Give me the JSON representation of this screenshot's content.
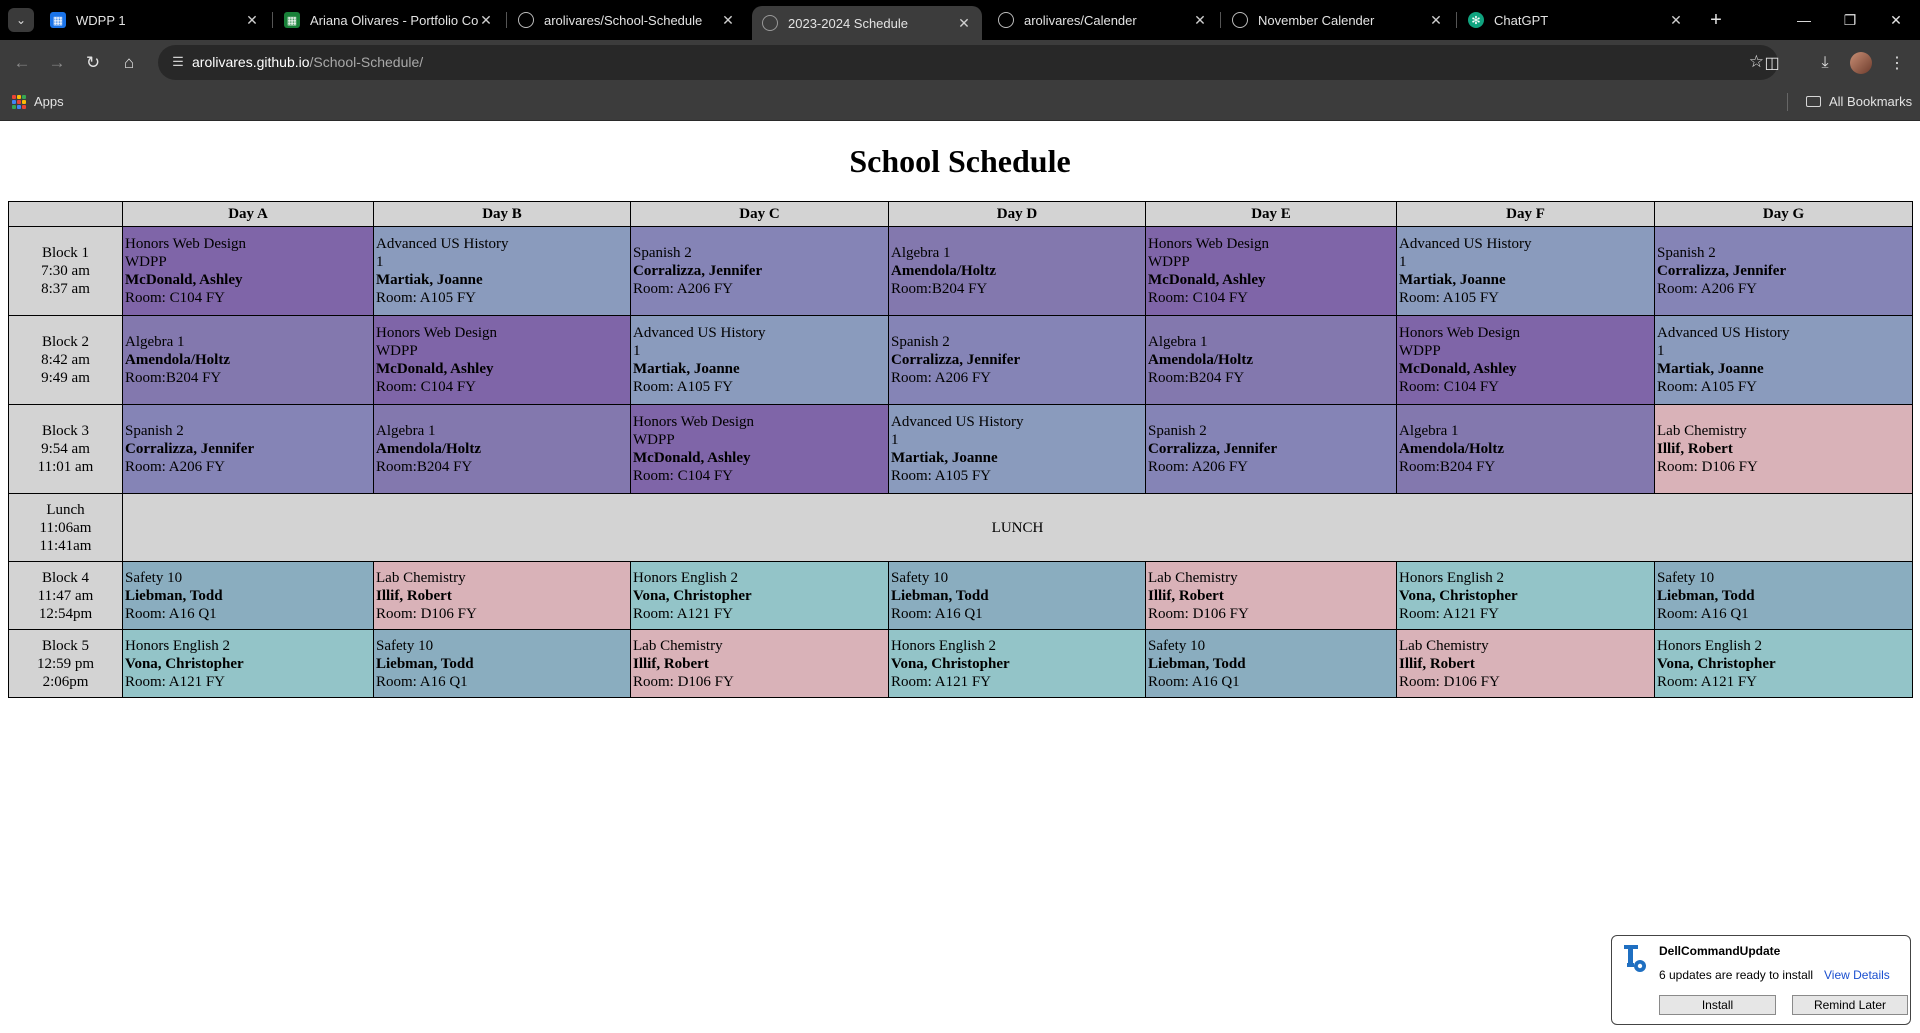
{
  "browser": {
    "tabs": [
      {
        "label": "WDPP 1",
        "icon": "site-icon"
      },
      {
        "label": "Ariana Olivares - Portfolio Cont",
        "icon": "sheets-icon"
      },
      {
        "label": "arolivares/School-Schedule",
        "icon": "github-icon"
      },
      {
        "label": "2023-2024 Schedule",
        "icon": "globe-icon"
      },
      {
        "label": "arolivares/Calender",
        "icon": "github-icon"
      },
      {
        "label": "November Calender",
        "icon": "globe-icon"
      },
      {
        "label": "ChatGPT",
        "icon": "chatgpt-icon"
      }
    ],
    "active_tab": "2023-2024 Schedule",
    "url_host": "arolivares.github.io",
    "url_path": "/School-Schedule/",
    "bookmarks": {
      "apps_label": "Apps",
      "all_label": "All Bookmarks"
    }
  },
  "page": {
    "title": "School Schedule",
    "days": [
      "Day A",
      "Day B",
      "Day C",
      "Day D",
      "Day E",
      "Day F",
      "Day G"
    ],
    "rows": [
      {
        "block": [
          "Block 1",
          "7:30 am",
          "8:37 am"
        ],
        "cells": [
          {
            "type": "webdesign",
            "lines": [
              "Honors Web Design",
              "WDPP"
            ],
            "teacher": "McDonald, Ashley",
            "room": "Room: C104 FY"
          },
          {
            "type": "history",
            "lines": [
              "Advanced US History",
              "1"
            ],
            "teacher": "Martiak, Joanne",
            "room": "Room: A105 FY"
          },
          {
            "type": "spanish",
            "lines": [
              "Spanish 2"
            ],
            "teacher": "Corralizza, Jennifer",
            "room": "Room: A206 FY"
          },
          {
            "type": "algebra",
            "lines": [
              "Algebra 1"
            ],
            "teacher": "Amendola/Holtz",
            "room": "Room:B204 FY"
          },
          {
            "type": "webdesign",
            "lines": [
              "Honors Web Design",
              "WDPP"
            ],
            "teacher": "McDonald, Ashley",
            "room": "Room: C104 FY"
          },
          {
            "type": "history",
            "lines": [
              "Advanced US History",
              "1"
            ],
            "teacher": "Martiak, Joanne",
            "room": "Room: A105 FY"
          },
          {
            "type": "spanish",
            "lines": [
              "Spanish 2"
            ],
            "teacher": "Corralizza, Jennifer",
            "room": "Room: A206 FY"
          }
        ]
      },
      {
        "block": [
          "Block 2",
          "8:42 am",
          "9:49 am"
        ],
        "cells": [
          {
            "type": "algebra",
            "lines": [
              "Algebra 1"
            ],
            "teacher": "Amendola/Holtz",
            "room": "Room:B204 FY"
          },
          {
            "type": "webdesign",
            "lines": [
              "Honors Web Design",
              "WDPP"
            ],
            "teacher": "McDonald, Ashley",
            "room": "Room: C104 FY"
          },
          {
            "type": "history",
            "lines": [
              "Advanced US History",
              "1"
            ],
            "teacher": "Martiak, Joanne",
            "room": "Room: A105 FY"
          },
          {
            "type": "spanish",
            "lines": [
              "Spanish 2"
            ],
            "teacher": "Corralizza, Jennifer",
            "room": "Room: A206 FY"
          },
          {
            "type": "algebra",
            "lines": [
              "Algebra 1"
            ],
            "teacher": "Amendola/Holtz",
            "room": "Room:B204 FY"
          },
          {
            "type": "webdesign",
            "lines": [
              "Honors Web Design",
              "WDPP"
            ],
            "teacher": "McDonald, Ashley",
            "room": "Room: C104 FY"
          },
          {
            "type": "history",
            "lines": [
              "Advanced US History",
              "1"
            ],
            "teacher": "Martiak, Joanne",
            "room": "Room: A105 FY"
          }
        ]
      },
      {
        "block": [
          "Block 3",
          "9:54 am",
          "11:01 am"
        ],
        "cells": [
          {
            "type": "spanish",
            "lines": [
              "Spanish 2"
            ],
            "teacher": "Corralizza, Jennifer",
            "room": "Room: A206 FY"
          },
          {
            "type": "algebra",
            "lines": [
              "Algebra 1"
            ],
            "teacher": "Amendola/Holtz",
            "room": "Room:B204 FY"
          },
          {
            "type": "webdesign",
            "lines": [
              "Honors Web Design",
              "WDPP"
            ],
            "teacher": "McDonald, Ashley",
            "room": "Room: C104 FY"
          },
          {
            "type": "history",
            "lines": [
              "Advanced US History",
              "1"
            ],
            "teacher": "Martiak, Joanne",
            "room": "Room: A105 FY"
          },
          {
            "type": "spanish",
            "lines": [
              "Spanish 2"
            ],
            "teacher": "Corralizza, Jennifer",
            "room": "Room: A206 FY"
          },
          {
            "type": "algebra",
            "lines": [
              "Algebra 1"
            ],
            "teacher": "Amendola/Holtz",
            "room": "Room:B204 FY"
          },
          {
            "type": "chem",
            "lines": [
              "Lab Chemistry"
            ],
            "teacher": "Illif, Robert",
            "room": "Room: D106 FY"
          }
        ]
      },
      {
        "block": [
          "Lunch",
          "11:06am",
          "11:41am"
        ],
        "lunch": "LUNCH"
      },
      {
        "block": [
          "Block 4",
          "11:47 am",
          "12:54pm"
        ],
        "cells": [
          {
            "type": "safety",
            "lines": [
              "Safety 10"
            ],
            "teacher": "Liebman, Todd",
            "room": "Room: A16 Q1"
          },
          {
            "type": "chem",
            "lines": [
              "Lab Chemistry"
            ],
            "teacher": "Illif, Robert",
            "room": "Room: D106 FY"
          },
          {
            "type": "english",
            "lines": [
              "Honors English 2"
            ],
            "teacher": "Vona, Christopher",
            "room": "Room: A121 FY"
          },
          {
            "type": "safety",
            "lines": [
              "Safety 10"
            ],
            "teacher": "Liebman, Todd",
            "room": "Room: A16 Q1"
          },
          {
            "type": "chem",
            "lines": [
              "Lab Chemistry"
            ],
            "teacher": "Illif, Robert",
            "room": "Room: D106 FY"
          },
          {
            "type": "english",
            "lines": [
              "Honors English 2"
            ],
            "teacher": "Vona, Christopher",
            "room": "Room: A121 FY"
          },
          {
            "type": "safety",
            "lines": [
              "Safety 10"
            ],
            "teacher": "Liebman, Todd",
            "room": "Room: A16 Q1"
          }
        ]
      },
      {
        "block": [
          "Block 5",
          "12:59 pm",
          "2:06pm"
        ],
        "cells": [
          {
            "type": "english",
            "lines": [
              "Honors English 2"
            ],
            "teacher": "Vona, Christopher",
            "room": "Room: A121 FY"
          },
          {
            "type": "safety",
            "lines": [
              "Safety 10"
            ],
            "teacher": "Liebman, Todd",
            "room": "Room: A16 Q1"
          },
          {
            "type": "chem",
            "lines": [
              "Lab Chemistry"
            ],
            "teacher": "Illif, Robert",
            "room": "Room: D106 FY"
          },
          {
            "type": "english",
            "lines": [
              "Honors English 2"
            ],
            "teacher": "Vona, Christopher",
            "room": "Room: A121 FY"
          },
          {
            "type": "safety",
            "lines": [
              "Safety 10"
            ],
            "teacher": "Liebman, Todd",
            "room": "Room: A16 Q1"
          },
          {
            "type": "chem",
            "lines": [
              "Lab Chemistry"
            ],
            "teacher": "Illif, Robert",
            "room": "Room: D106 FY"
          },
          {
            "type": "english",
            "lines": [
              "Honors English 2"
            ],
            "teacher": "Vona, Christopher",
            "room": "Room: A121 FY"
          }
        ]
      }
    ]
  },
  "notification": {
    "app": "DellCommandUpdate",
    "message": "6 updates are ready to install",
    "link": "View Details",
    "install_label": "Install",
    "remind_label": "Remind Later"
  },
  "colors": {
    "webdesign": "#7f65a8",
    "history": "#8a9bbd",
    "spanish": "#8584b6",
    "algebra": "#8378ae",
    "chem": "#d9b2b8",
    "english": "#93c4c8",
    "safety": "#8aadbf",
    "header_gray": "#d3d3d3"
  }
}
